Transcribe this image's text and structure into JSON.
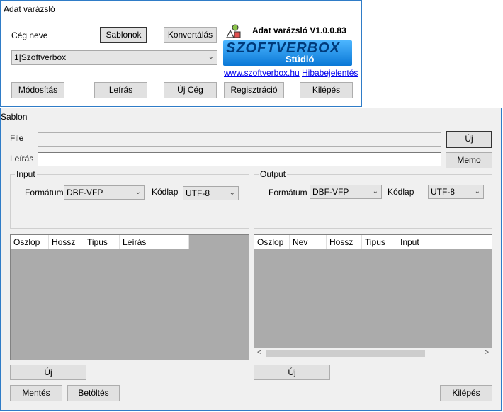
{
  "main": {
    "title": "Adat varázsló",
    "company_label": "Cég neve",
    "templates_btn": "Sablonok",
    "convert_btn": "Konvertálás",
    "company_value": "1|Szoftverbox",
    "app_version": "Adat varázsló V1.0.0.83",
    "logo_text_top": "SZOFTVERBOX",
    "logo_text_bottom": "Stúdió",
    "website_link": "www.szoftverbox.hu",
    "bug_link": "Hibabejelentés",
    "buttons": [
      "Módosítás",
      "Leírás",
      "Új Cég",
      "Regisztráció",
      "Kilépés"
    ]
  },
  "sablon": {
    "title": "Sablon",
    "file_label": "File",
    "file_value": "",
    "new_btn": "Új",
    "desc_label": "Leírás",
    "desc_value": "",
    "memo_btn": "Memo",
    "input_group": {
      "title": "Input",
      "format_label": "Formátum",
      "format_value": "DBF-VFP",
      "codepage_label": "Kódlap",
      "codepage_value": "UTF-8"
    },
    "output_group": {
      "title": "Output",
      "format_label": "Formátum",
      "format_value": "DBF-VFP",
      "codepage_label": "Kódlap",
      "codepage_value": "UTF-8"
    },
    "input_grid_columns": [
      "Oszlop",
      "Hossz",
      "Tipus",
      "Leírás"
    ],
    "output_grid_columns": [
      "Oszlop",
      "Nev",
      "Hossz",
      "Tipus",
      "Input"
    ],
    "input_new_btn": "Új",
    "output_new_btn": "Új",
    "save_btn": "Mentés",
    "load_btn": "Betöltés",
    "exit_btn": "Kilépés"
  },
  "colors": {
    "window_border": "#2f7cc7",
    "grid_bg": "#ababab",
    "link": "#0000ee"
  }
}
